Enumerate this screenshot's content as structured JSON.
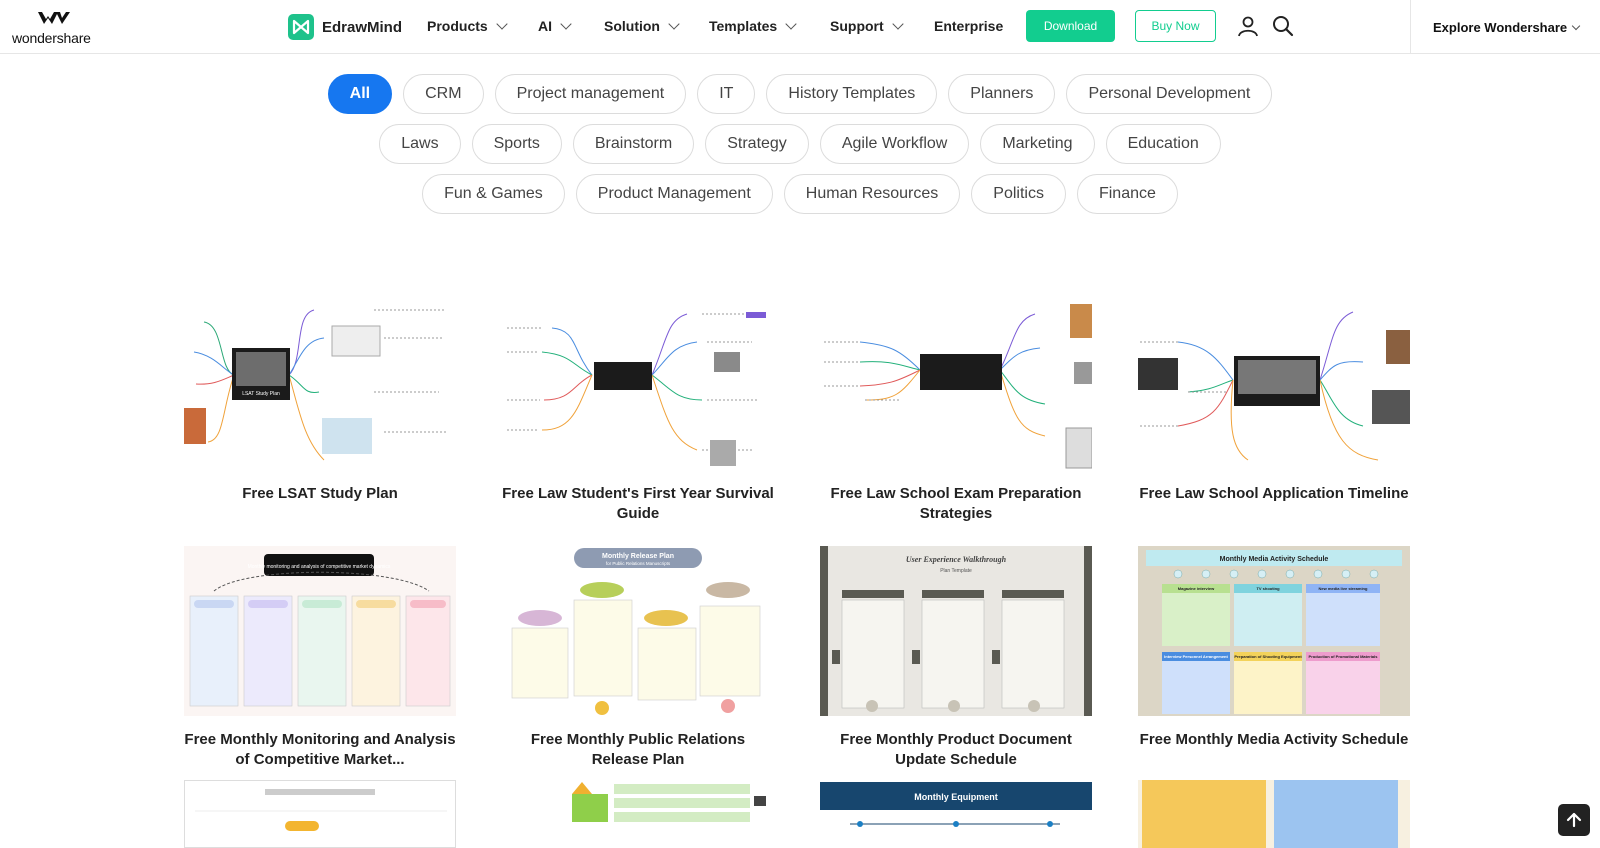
{
  "header": {
    "wondershare_logo_text": "wondershare",
    "brand_name": "EdrawMind",
    "nav": [
      {
        "label": "Products",
        "has_dropdown": true
      },
      {
        "label": "AI",
        "has_dropdown": true
      },
      {
        "label": "Solution",
        "has_dropdown": true
      },
      {
        "label": "Templates",
        "has_dropdown": true
      },
      {
        "label": "Support",
        "has_dropdown": true
      },
      {
        "label": "Enterprise",
        "has_dropdown": false
      }
    ],
    "download_label": "Download",
    "buy_label": "Buy Now",
    "explore_label": "Explore Wondershare",
    "icons": [
      "user-icon",
      "search-icon"
    ]
  },
  "filters": {
    "active": "All",
    "rows": [
      [
        "All",
        "CRM",
        "Project management",
        "IT",
        "History Templates",
        "Planners",
        "Personal Development"
      ],
      [
        "Laws",
        "Sports",
        "Brainstorm",
        "Strategy",
        "Agile Workflow",
        "Marketing",
        "Education"
      ],
      [
        "Fun & Games",
        "Product Management",
        "Human Resources",
        "Politics",
        "Finance"
      ]
    ]
  },
  "templates": [
    {
      "title": "Free LSAT Study Plan",
      "thumb_title": "LSAT Study Plan",
      "style": "mindmap"
    },
    {
      "title": "Free Law Student's First Year Survival Guide",
      "thumb_title": "",
      "style": "mindmap"
    },
    {
      "title": "Free Law School Exam Preparation Strategies",
      "thumb_title": "",
      "style": "mindmap"
    },
    {
      "title": "Free Law School Application Timeline",
      "thumb_title": "",
      "style": "mindmap"
    },
    {
      "title": "Free Monthly Monitoring and Analysis of Competitive Market...",
      "thumb_title": "Monthly monitoring and analysis of competitive market dynamics",
      "style": "columns"
    },
    {
      "title": "Free Monthly Public Relations Release Plan",
      "thumb_title": "Monthly Release Plan",
      "thumb_subtitle": "for Public Relations Manuscripts",
      "style": "release"
    },
    {
      "title": "Free Monthly Product Document Update Schedule",
      "thumb_title": "User Experience Walkthrough",
      "thumb_subtitle": "Plan Template",
      "style": "walkthrough"
    },
    {
      "title": "Free Monthly Media Activity Schedule",
      "thumb_title": "Monthly Media Activity Schedule",
      "thumb_cells": [
        "Magazine interview",
        "TV shooting",
        "New media live streaming",
        "Interview Personnel Arrangement",
        "Preparation of Shooting Equipment",
        "Production of Promotional Materials"
      ],
      "style": "media"
    },
    {
      "title": "",
      "style": "partial-a"
    },
    {
      "title": "",
      "style": "partial-b"
    },
    {
      "title": "",
      "thumb_title": "Monthly Equipment",
      "style": "partial-c"
    },
    {
      "title": "",
      "style": "partial-d"
    }
  ],
  "colors": {
    "accent_green": "#12cd8f",
    "active_blue": "#1677f0"
  }
}
